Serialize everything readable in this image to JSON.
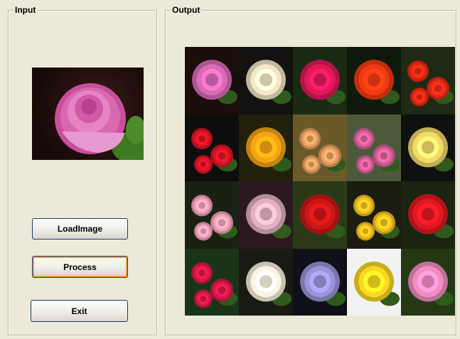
{
  "input_group": {
    "title": "Input"
  },
  "output_group": {
    "title": "Output"
  },
  "buttons": {
    "load_label": "LoadImage",
    "process_label": "Process",
    "exit_label": "Exit"
  },
  "input_image": {
    "subject": "pink rose"
  },
  "output_images": [
    {
      "subject": "pink rose",
      "color": "#d96bb5",
      "bg": "#1a0d0a"
    },
    {
      "subject": "cream rose",
      "color": "#f3e7c6",
      "bg": "#141210"
    },
    {
      "subject": "magenta rose",
      "color": "#e0185a",
      "bg": "#1b2a12"
    },
    {
      "subject": "red-orange rose",
      "color": "#f23a12",
      "bg": "#0f1a0c"
    },
    {
      "subject": "red roses",
      "color": "#e32a14",
      "bg": "#1e2a14"
    },
    {
      "subject": "red roses",
      "color": "#d91425",
      "bg": "#0d0d0d"
    },
    {
      "subject": "yellow-orange rose",
      "color": "#f5a514",
      "bg": "#20200c"
    },
    {
      "subject": "peach roses",
      "color": "#e8a060",
      "bg": "#6a5a2a"
    },
    {
      "subject": "pink roses",
      "color": "#d8609a",
      "bg": "#4a5a3a"
    },
    {
      "subject": "yellow rose",
      "color": "#f3da6a",
      "bg": "#101010"
    },
    {
      "subject": "light pink roses",
      "color": "#f0a0b8",
      "bg": "#1a2012"
    },
    {
      "subject": "pale pink rose",
      "color": "#e2b0c0",
      "bg": "#2a1a20"
    },
    {
      "subject": "red rose",
      "color": "#cc1616",
      "bg": "#2a3a16"
    },
    {
      "subject": "yellow roses",
      "color": "#f4c020",
      "bg": "#1c1c10"
    },
    {
      "subject": "red rose",
      "color": "#e01820",
      "bg": "#1a2410"
    },
    {
      "subject": "red rose bush",
      "color": "#d81848",
      "bg": "#1a3418"
    },
    {
      "subject": "white rose",
      "color": "#f8f4e0",
      "bg": "#1a1a14"
    },
    {
      "subject": "lavender flower",
      "color": "#9a94d8",
      "bg": "#101018"
    },
    {
      "subject": "yellow daffodil",
      "color": "#f8d820",
      "bg": "#f2f2f2"
    },
    {
      "subject": "pink flower",
      "color": "#f08cc0",
      "bg": "#243814"
    }
  ]
}
